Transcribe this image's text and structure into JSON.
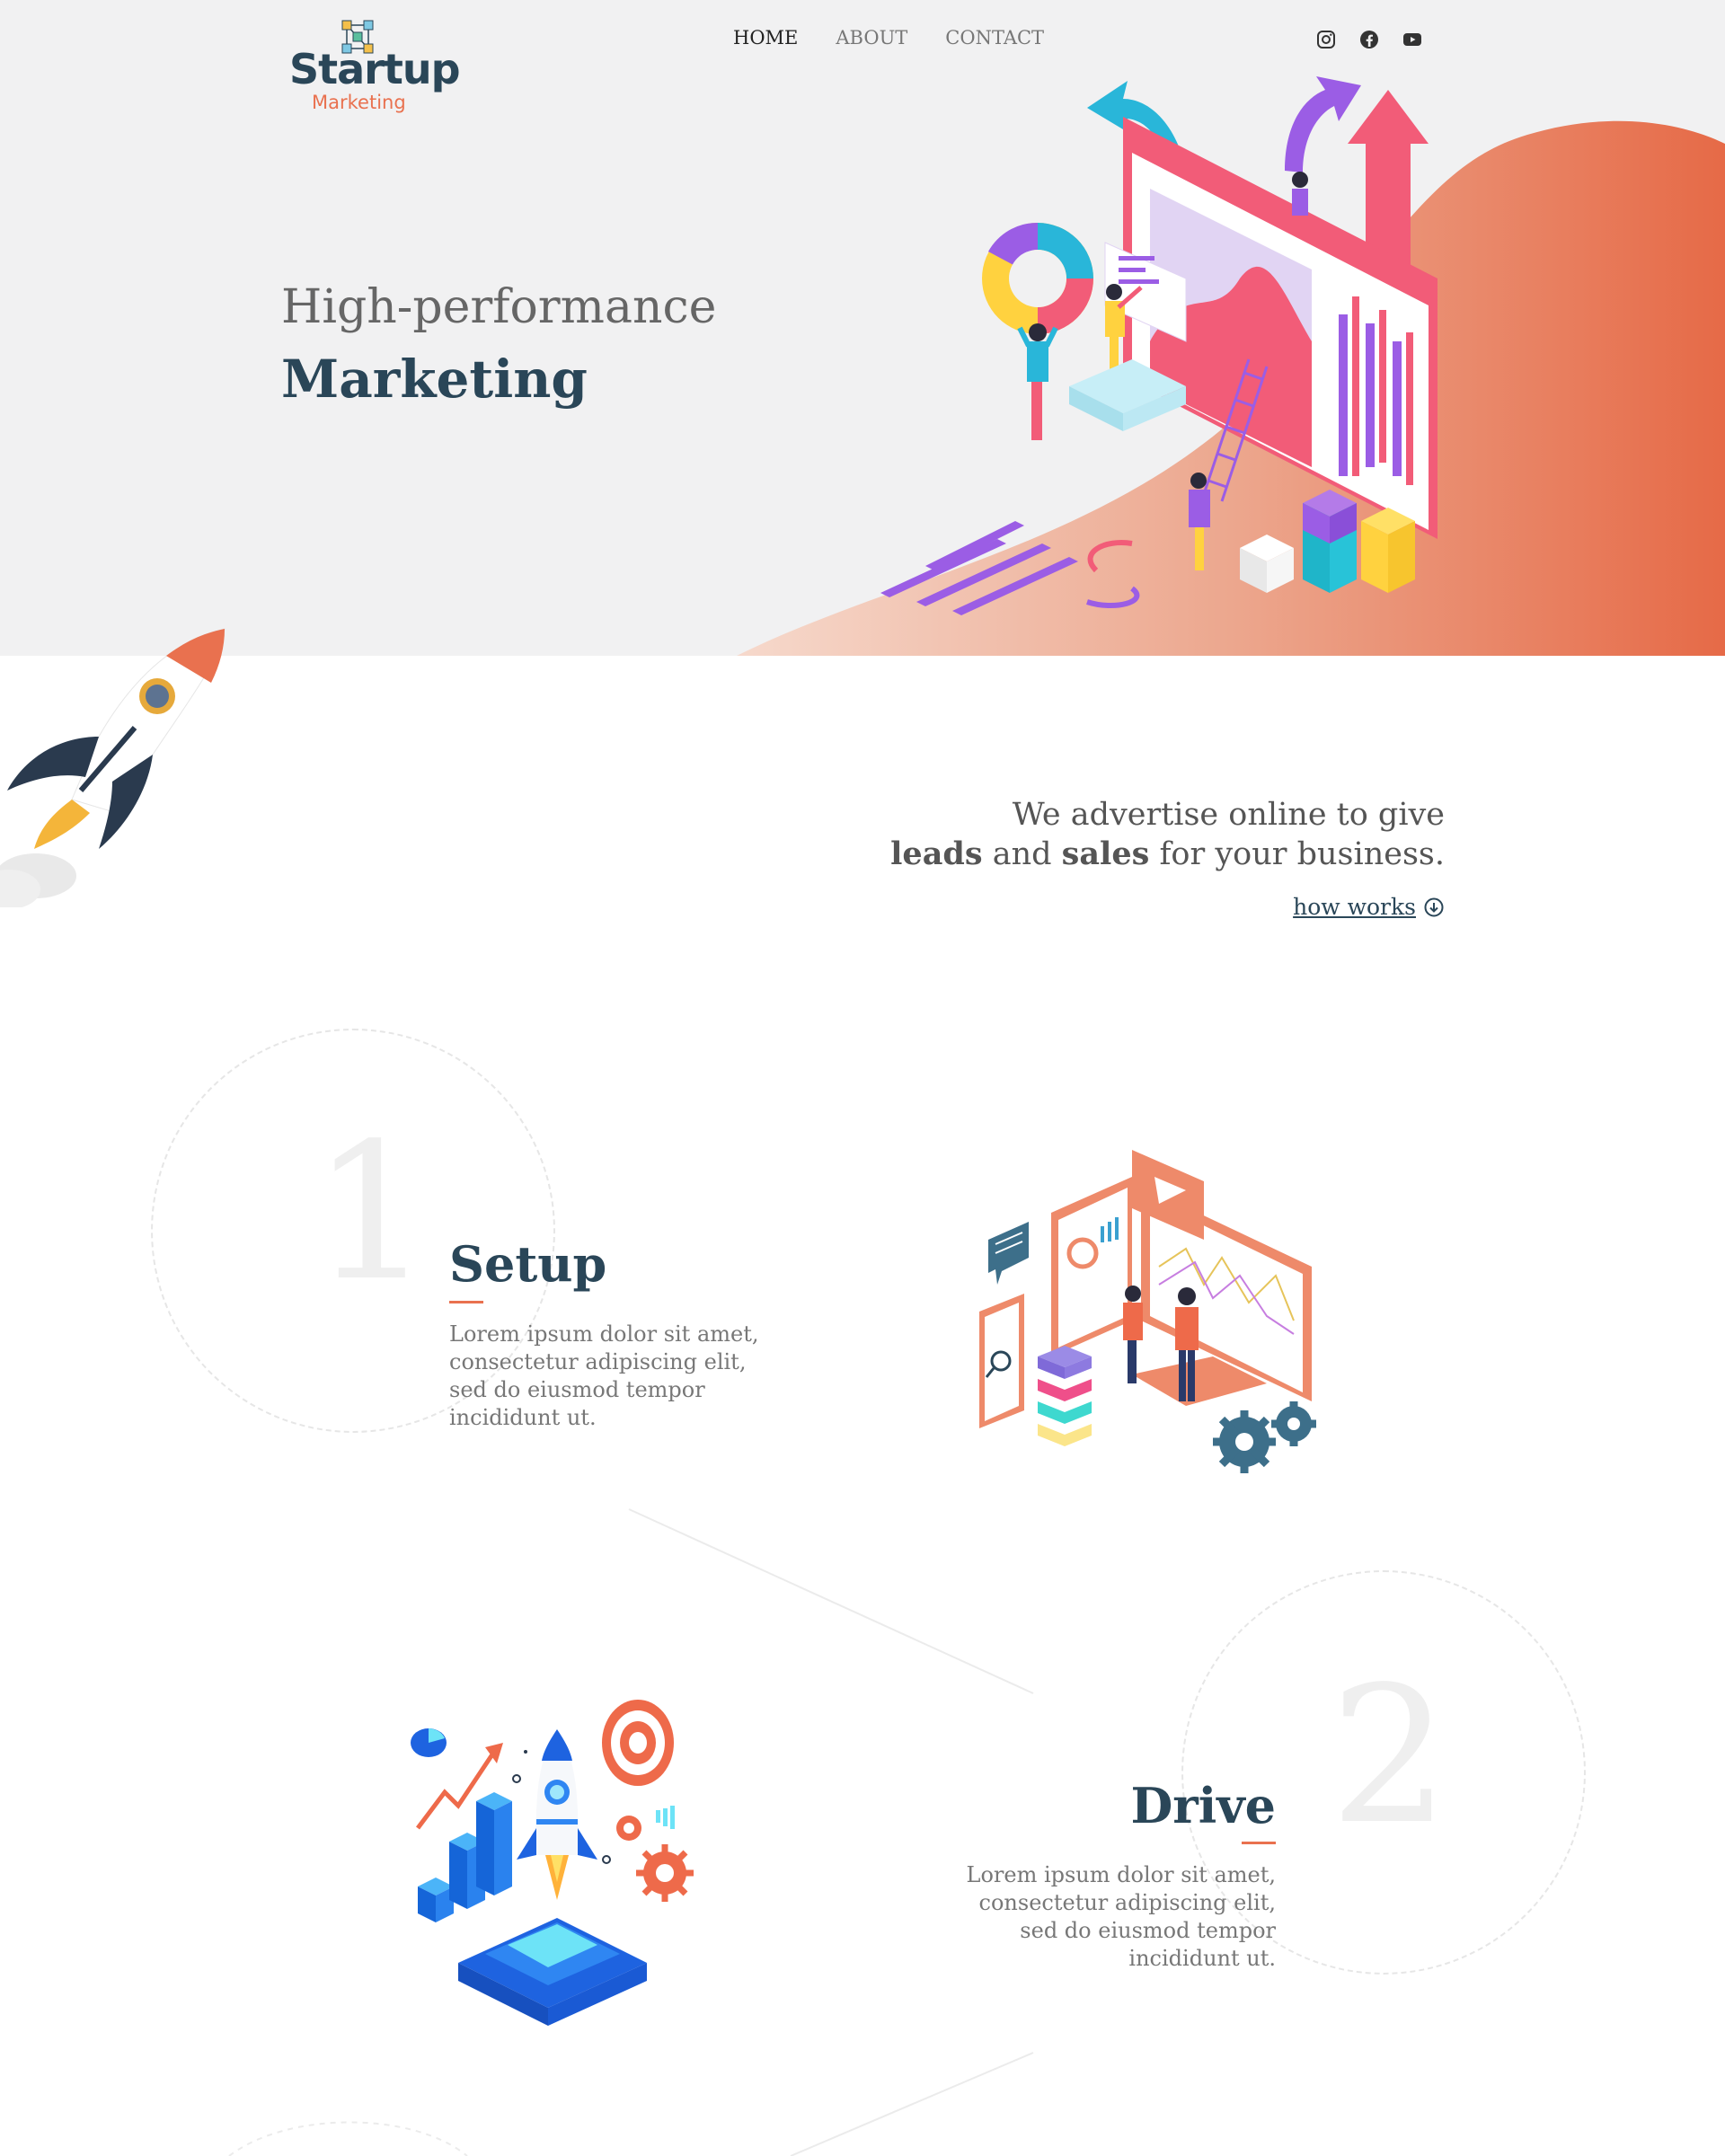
{
  "brand": {
    "name": "Startup",
    "tagline": "Marketing"
  },
  "nav": {
    "items": [
      {
        "label": "HOME",
        "active": true
      },
      {
        "label": "ABOUT",
        "active": false
      },
      {
        "label": "CONTACT",
        "active": false
      }
    ]
  },
  "social": [
    {
      "icon": "instagram-icon"
    },
    {
      "icon": "facebook-icon"
    },
    {
      "icon": "youtube-icon"
    }
  ],
  "hero": {
    "line1": "High-performance",
    "line2": "Marketing"
  },
  "intro": {
    "line1": "We advertise online to give",
    "line2_word1": "leads",
    "line2_mid": "and",
    "line2_word2": "sales",
    "line2_end": "for your business.",
    "link": "how works"
  },
  "steps": [
    {
      "number": "1",
      "title": "Setup",
      "text": "Lorem ipsum dolor sit amet,\nconsectetur adipiscing elit,\nsed do eiusmod tempor\nincididunt ut."
    },
    {
      "number": "2",
      "title": "Drive",
      "text": "Lorem ipsum dolor sit amet,\nconsectetur adipiscing elit,\nsed do eiusmod tempor\nincididunt ut."
    }
  ],
  "colors": {
    "accent": "#e9714f",
    "navy": "#2a4658",
    "hero_bg": "#f1f1f2"
  }
}
